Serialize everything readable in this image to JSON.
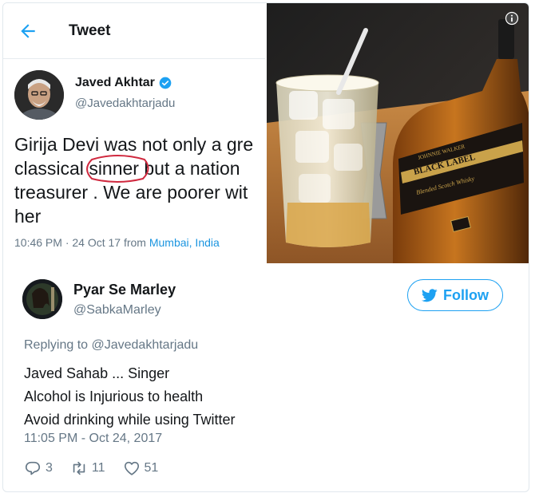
{
  "embedded_tweet": {
    "header_title": "Tweet",
    "author_name": "Javed Akhtar",
    "author_handle": "@Javedakhtarjadu",
    "text_lines": [
      {
        "before": "Girija Devi was not only a gre",
        "circled": "",
        "after": ""
      },
      {
        "before": "classical ",
        "circled": "sinner",
        "after": " but a nation"
      },
      {
        "before": "treasurer . We are poorer wit",
        "circled": "",
        "after": ""
      },
      {
        "before": "her",
        "circled": "",
        "after": ""
      }
    ],
    "meta_prefix": "10:46 PM · 24 Oct 17 from ",
    "meta_location": "Mumbai, India"
  },
  "photo": {
    "label_band": "BLACK LABEL",
    "label_small": "JOHNNIE WALKER",
    "label_script": "Blended Scotch Whisky"
  },
  "reply": {
    "author_name": "Pyar Se Marley",
    "author_handle": "@SabkaMarley",
    "follow_label": "Follow",
    "replying_to": "Replying to @Javedakhtarjadu",
    "lines": [
      "Javed Sahab ... Singer",
      "Alcohol is Injurious to health",
      "Avoid drinking while using Twitter"
    ],
    "timestamp": "11:05 PM - Oct 24, 2017",
    "replies_count": "3",
    "retweets_count": "11",
    "likes_count": "51"
  },
  "colors": {
    "twitter_blue": "#1da1f2",
    "secondary_text": "#657786",
    "circle_red": "#d0293f"
  },
  "icons": {
    "back": "arrow-left-icon",
    "verified": "verified-badge-icon",
    "info": "info-icon",
    "follow": "twitter-bird-icon",
    "reply": "reply-icon",
    "retweet": "retweet-icon",
    "like": "heart-icon"
  }
}
